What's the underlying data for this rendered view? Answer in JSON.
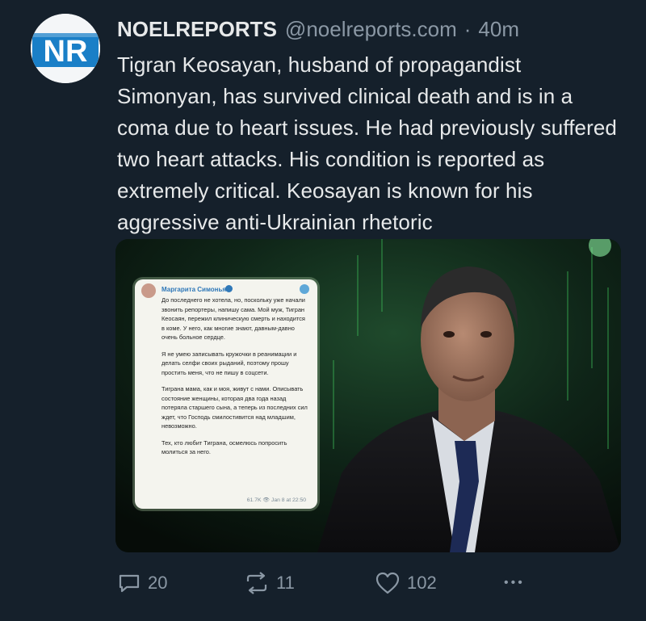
{
  "author": {
    "name": "NOELREPORTS",
    "handle": "@noelreports.com",
    "separator": "·",
    "time": "40m",
    "avatar_text": "NR"
  },
  "post": {
    "text": "Tigran Keosayan, husband of propagandist Simonyan, has survived clinical death and is in a coma due to heart issues. He had previously suffered two heart attacks. His condition is reported as extremely critical. Keosayan is known for his aggressive anti-Ukrainian rhetoric"
  },
  "media": {
    "card": {
      "channel": "Маргарита Симоньян",
      "paragraphs": [
        "До последнего не хотела, но, поскольку уже начали звонить репортеры, напишу сама. Мой муж, Тигран Кеосаян, пережил клиническую смерть и находится в коме. У него, как многие знают, давным-давно очень больное сердце.",
        "Я не умею записывать кружочки в реанимации и делать селфи своих рыданий, поэтому прошу простить меня, что не пишу в соцсети.",
        "Тиграна мама, как и моя, живут с нами. Описывать состояние женщины, которая два года назад потеряла старшего сына, а теперь из последних сил ждет, что Господь смилостивится над младшим, невозможно.",
        "Тех, кто любит Тиграна, осмелюсь попросить молиться за него."
      ],
      "footer": "61.7K 👁 Jan 8 at 22:50"
    }
  },
  "actions": {
    "replies": "20",
    "reposts": "11",
    "likes": "102",
    "more": "•••"
  },
  "colors": {
    "background": "#15202b",
    "text": "#e7e9ea",
    "muted": "#8b98a5",
    "brand_blue": "#1a7fc7"
  }
}
